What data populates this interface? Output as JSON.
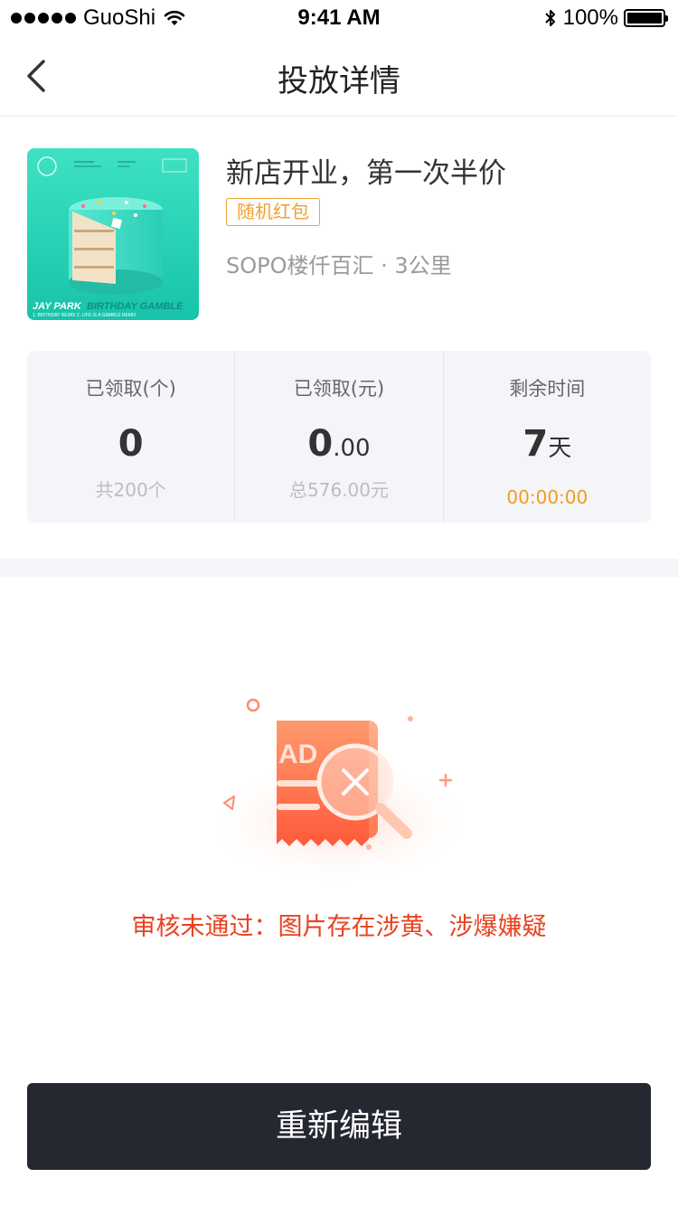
{
  "status_bar": {
    "carrier": "GuoShi",
    "time": "9:41 AM",
    "battery": "100%",
    "battery_level": 1.0
  },
  "nav": {
    "title": "投放详情",
    "back_icon": "chevron-left-icon"
  },
  "campaign": {
    "title": "新店开业，第一次半价",
    "tag": "随机红包",
    "meta": "SOPO楼仟百汇 · 3公里",
    "thumbnail": {
      "artist": "JAY PARK",
      "album": "BIRTHDAY GAMBLE",
      "tracks": "1. BIRTHDAY REMIX  2. LIFE IS A GAMBLE REMIX"
    }
  },
  "stats": [
    {
      "label": "已领取(个)",
      "value": "0",
      "value_small": "",
      "sub": "共200个"
    },
    {
      "label": "已领取(元)",
      "value": "0",
      "value_small": ".00",
      "sub": "总576.00元"
    },
    {
      "label": "剩余时间",
      "value": "7",
      "value_small": "天",
      "sub": "00:00:00"
    }
  ],
  "review": {
    "illustration_icon": "ad-rejected-icon",
    "illustration_text": "AD",
    "message": "审核未通过：图片存在涉黄、涉爆嫌疑"
  },
  "actions": {
    "edit_label": "重新编辑"
  },
  "colors": {
    "accent_orange": "#f39b1e",
    "error_red": "#e8421f",
    "button_dark": "#252731",
    "panel_bg": "#f4f5f9"
  }
}
